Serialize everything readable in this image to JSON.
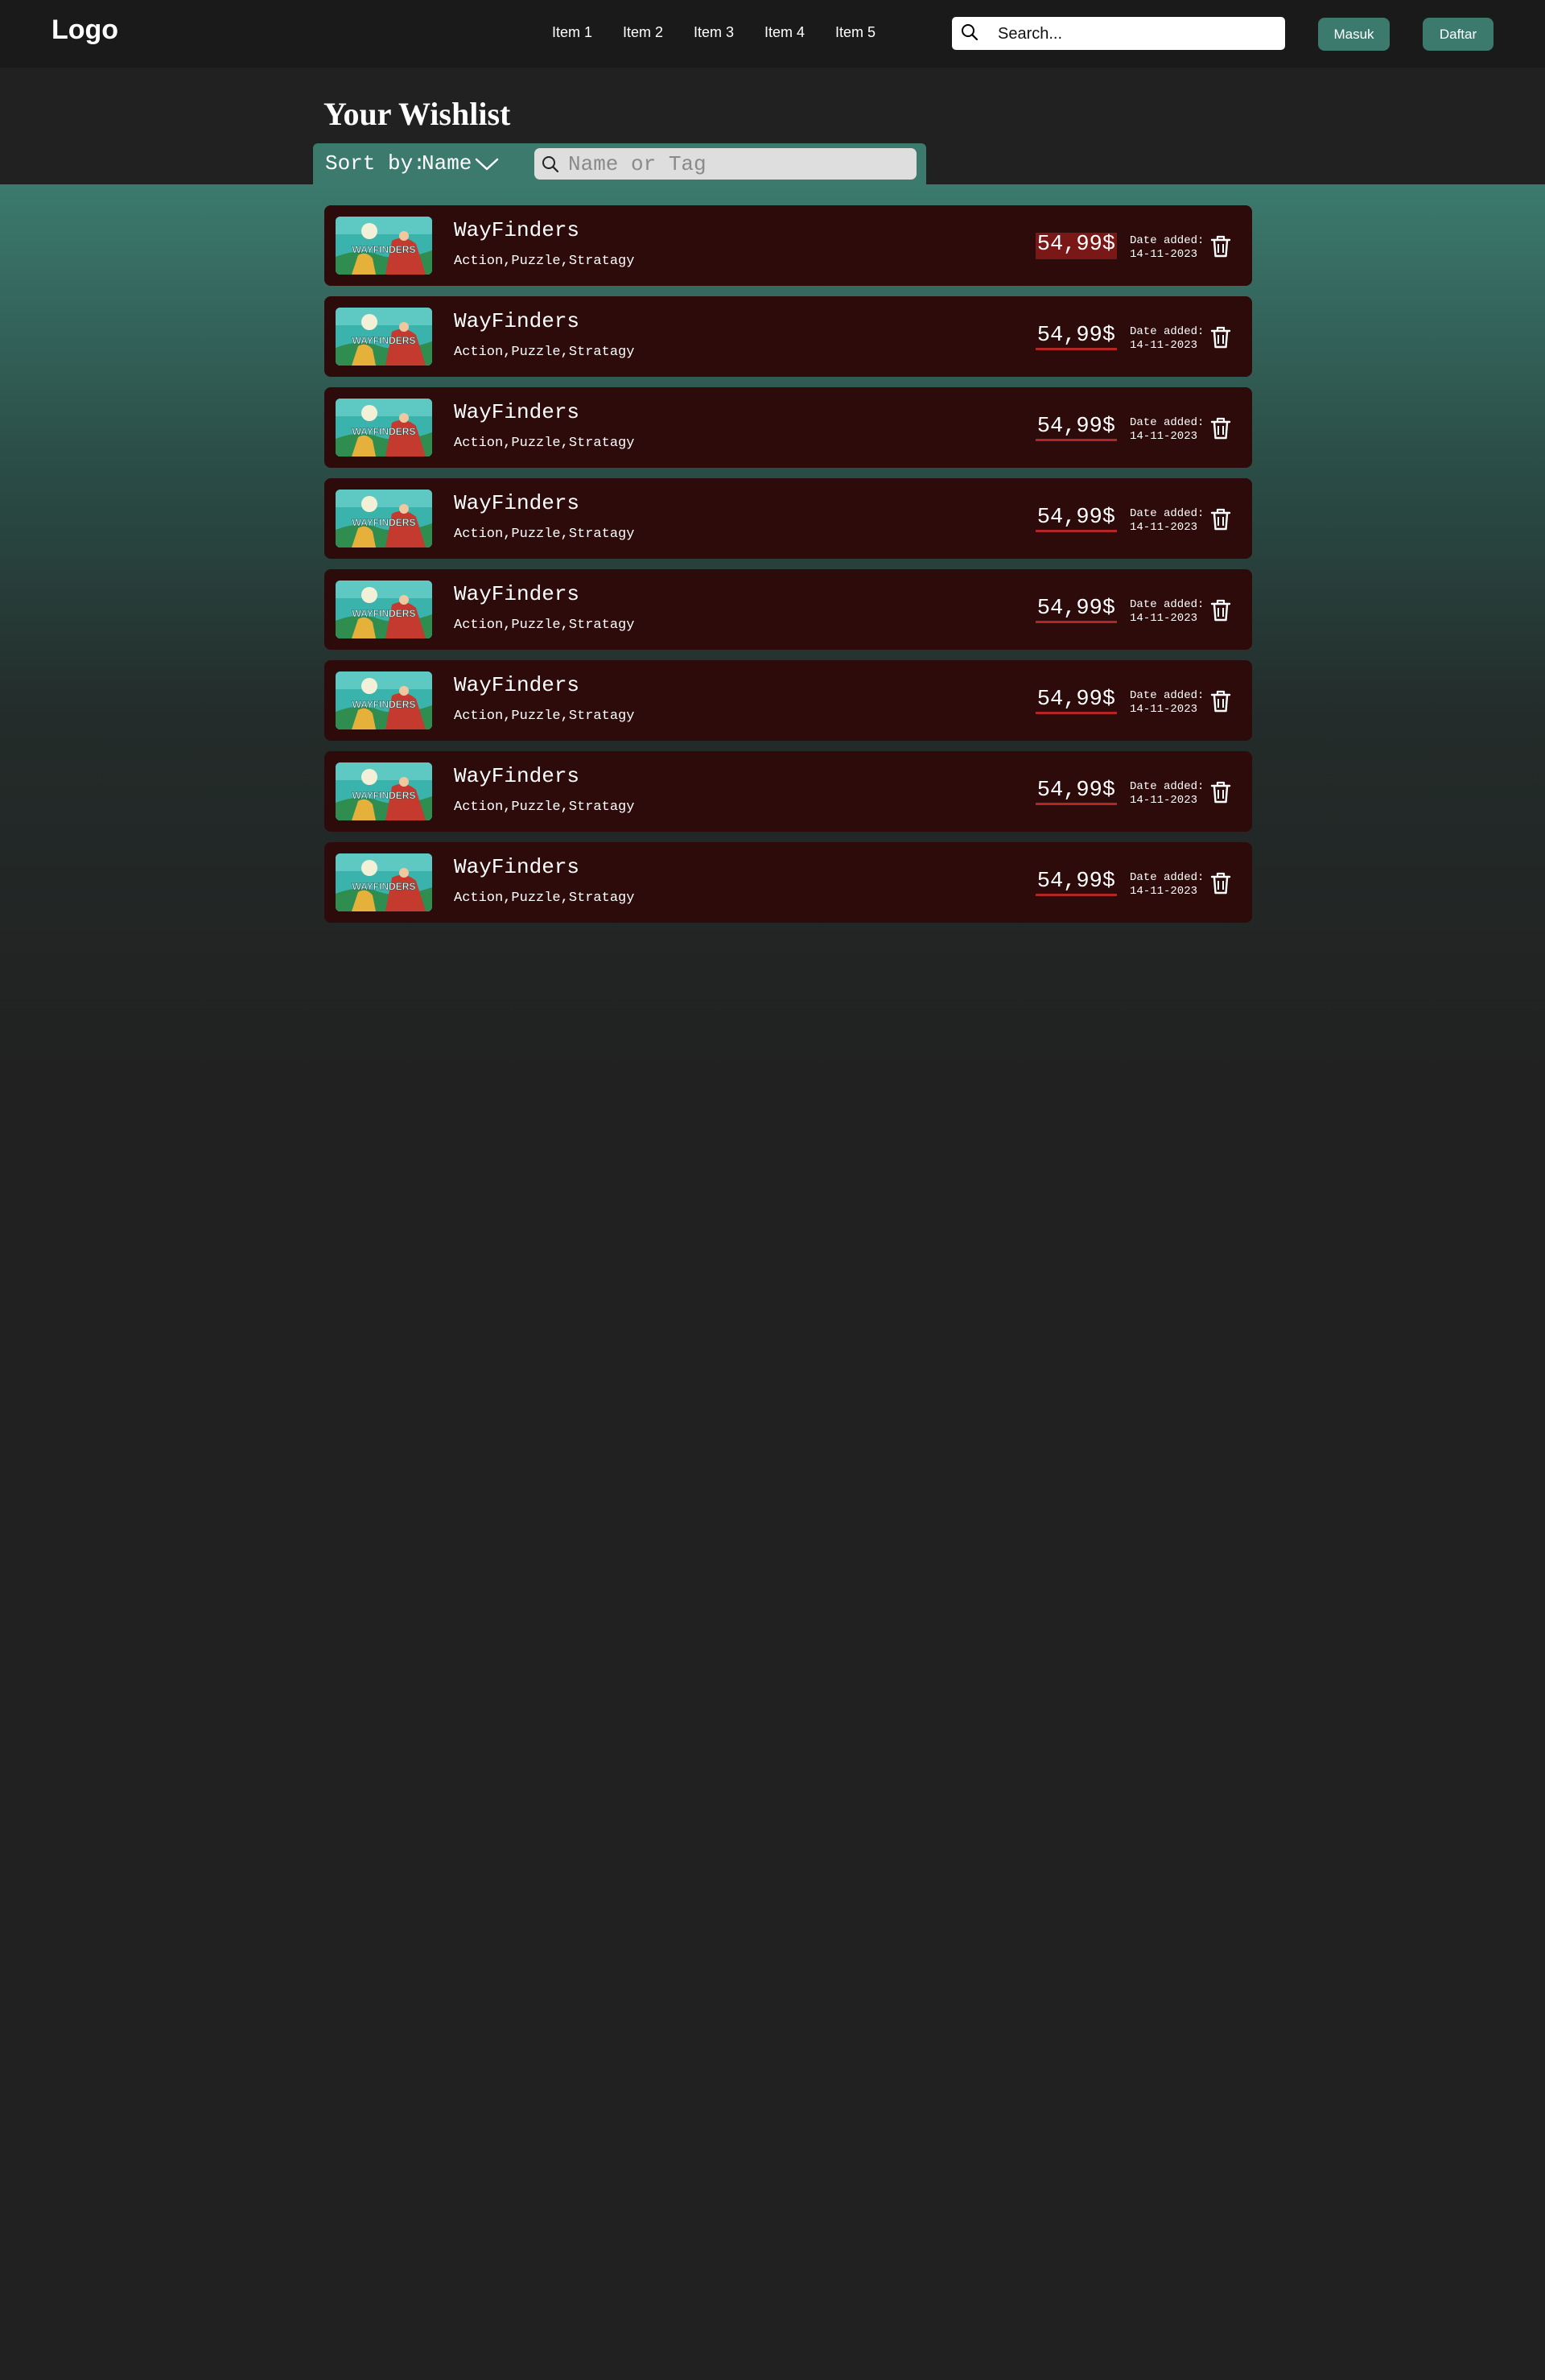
{
  "navbar": {
    "logo": "Logo",
    "items": [
      "Item 1",
      "Item 2",
      "Item 3",
      "Item 4",
      "Item 5"
    ],
    "search_placeholder": "Search...",
    "login_label": "Masuk",
    "register_label": "Daftar"
  },
  "page": {
    "title": "Your Wishlist",
    "sort_label": "Sort by:",
    "sort_value": "Name",
    "filter_placeholder": "Name or Tag"
  },
  "colors": {
    "accent": "#3c7a6e",
    "card_background": "#2d0b0b",
    "price_underline": "#b32626",
    "page_background": "#212121"
  },
  "wishlist": [
    {
      "cover_text": "WAYFINDERS",
      "title": "WayFinders",
      "tags": "Action,Puzzle,Stratagy",
      "price": "54,99$",
      "date_label": "Date added:",
      "date": "14-11-2023"
    },
    {
      "cover_text": "WAYFINDERS",
      "title": "WayFinders",
      "tags": "Action,Puzzle,Stratagy",
      "price": "54,99$",
      "date_label": "Date added:",
      "date": "14-11-2023"
    },
    {
      "cover_text": "WAYFINDERS",
      "title": "WayFinders",
      "tags": "Action,Puzzle,Stratagy",
      "price": "54,99$",
      "date_label": "Date added:",
      "date": "14-11-2023"
    },
    {
      "cover_text": "WAYFINDERS",
      "title": "WayFinders",
      "tags": "Action,Puzzle,Stratagy",
      "price": "54,99$",
      "date_label": "Date added:",
      "date": "14-11-2023"
    },
    {
      "cover_text": "WAYFINDERS",
      "title": "WayFinders",
      "tags": "Action,Puzzle,Stratagy",
      "price": "54,99$",
      "date_label": "Date added:",
      "date": "14-11-2023"
    },
    {
      "cover_text": "WAYFINDERS",
      "title": "WayFinders",
      "tags": "Action,Puzzle,Stratagy",
      "price": "54,99$",
      "date_label": "Date added:",
      "date": "14-11-2023"
    },
    {
      "cover_text": "WAYFINDERS",
      "title": "WayFinders",
      "tags": "Action,Puzzle,Stratagy",
      "price": "54,99$",
      "date_label": "Date added:",
      "date": "14-11-2023"
    },
    {
      "cover_text": "WAYFINDERS",
      "title": "WayFinders",
      "tags": "Action,Puzzle,Stratagy",
      "price": "54,99$",
      "date_label": "Date added:",
      "date": "14-11-2023"
    }
  ]
}
